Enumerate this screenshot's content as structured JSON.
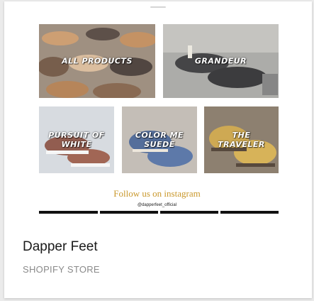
{
  "preview": {
    "tiles": [
      {
        "id": "all-products",
        "label": "ALL PRODUCTS"
      },
      {
        "id": "grandeur",
        "label": "GRANDEUR"
      },
      {
        "id": "pursuit-of-white",
        "label": "PURSUIT OF\nWHITE"
      },
      {
        "id": "color-me-suede",
        "label": "COLOR ME\nSUEDE"
      },
      {
        "id": "the-traveler",
        "label": "THE\nTRAVELER"
      }
    ],
    "follow_text": "Follow us on instagram",
    "instagram_handle": "@dapperfeet_official"
  },
  "store": {
    "name": "Dapper Feet",
    "type": "SHOPIFY STORE"
  }
}
